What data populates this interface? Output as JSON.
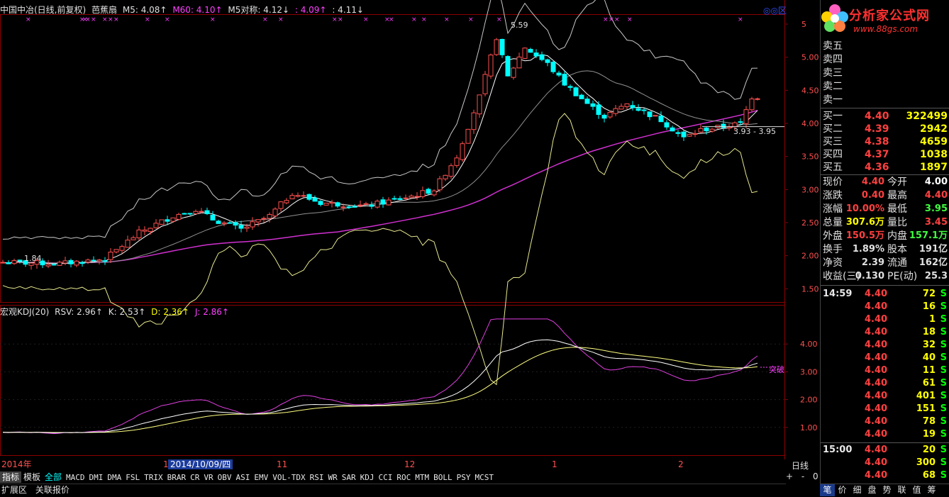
{
  "header": {
    "stock_name": "中国中冶(日线,前复权)",
    "indicator": "芭蕉扇",
    "m5": "M5: 4.08↑",
    "m60": "M60: 4.10↑",
    "m5dc": "M5对称: 4.12↓",
    "v1": ": 4.09↑",
    "v2": ": 4.11↓",
    "top_right": "◎◎区"
  },
  "kdj_header": {
    "title": "宏观KDJ(20)",
    "rsv": "RSV: 2.96↑",
    "k": "K: 2.53↑",
    "d": "D: 2.36↑",
    "j": "J: 2.86↑"
  },
  "annotations": {
    "high": "5.59",
    "low": "1.84",
    "range": "3.93 - 3.95",
    "breakout": "突破"
  },
  "xaxis": {
    "labels": [
      "2014年",
      "1",
      "2014/10/09/四",
      "11",
      "12",
      "1",
      "2"
    ],
    "period": "日线",
    "controls": "+ - 0"
  },
  "tabs": [
    "指标",
    "模板",
    "全部",
    "MACD",
    "DMI",
    "DMA",
    "FSL",
    "TRIX",
    "BRAR",
    "CR",
    "VR",
    "OBV",
    "ASI",
    "EMV",
    "VOL-TDX",
    "RSI",
    "WR",
    "SAR",
    "KDJ",
    "CCI",
    "ROC",
    "MTM",
    "BOLL",
    "PSY",
    "MCST"
  ],
  "status": [
    "扩展区",
    "关联报价"
  ],
  "logo": {
    "name": "分析家公式网",
    "url": "www.88gs.com"
  },
  "quote": {
    "sell": [
      {
        "label": "卖五"
      },
      {
        "label": "卖四"
      },
      {
        "label": "卖三"
      },
      {
        "label": "卖二"
      },
      {
        "label": "卖一"
      }
    ],
    "buy": [
      {
        "label": "买一",
        "price": "4.40",
        "vol": "322499"
      },
      {
        "label": "买二",
        "price": "4.39",
        "vol": "2942"
      },
      {
        "label": "买三",
        "price": "4.38",
        "vol": "4659"
      },
      {
        "label": "买四",
        "price": "4.37",
        "vol": "1038"
      },
      {
        "label": "买五",
        "price": "4.36",
        "vol": "1897"
      }
    ],
    "stats": [
      {
        "l1": "现价",
        "v1": "4.40",
        "l2": "今开",
        "v2": "4.00"
      },
      {
        "l1": "涨跌",
        "v1": "0.40",
        "l2": "最高",
        "v2": "4.40"
      },
      {
        "l1": "涨幅",
        "v1": "10.00%",
        "l2": "最低",
        "v2": "3.95"
      },
      {
        "l1": "总量",
        "v1": "307.6万",
        "l2": "量比",
        "v2": "3.45"
      },
      {
        "l1": "外盘",
        "v1": "150.5万",
        "l2": "内盘",
        "v2": "157.1万"
      },
      {
        "l1": "换手",
        "v1": "1.89%",
        "l2": "股本",
        "v2": "191亿"
      },
      {
        "l1": "净资",
        "v1": "2.39",
        "l2": "流通",
        "v2": "162亿"
      },
      {
        "l1": "收益(三)",
        "v1": "0.130",
        "l2": "PE(动)",
        "v2": "25.3"
      }
    ]
  },
  "ticks": [
    {
      "t": "14:59",
      "p": "4.40",
      "v": "72",
      "s": "S"
    },
    {
      "t": "",
      "p": "4.40",
      "v": "16",
      "s": "S"
    },
    {
      "t": "",
      "p": "4.40",
      "v": "1",
      "s": "S"
    },
    {
      "t": "",
      "p": "4.40",
      "v": "18",
      "s": "S"
    },
    {
      "t": "",
      "p": "4.40",
      "v": "32",
      "s": "S"
    },
    {
      "t": "",
      "p": "4.40",
      "v": "40",
      "s": "S"
    },
    {
      "t": "",
      "p": "4.40",
      "v": "11",
      "s": "S"
    },
    {
      "t": "",
      "p": "4.40",
      "v": "61",
      "s": "S"
    },
    {
      "t": "",
      "p": "4.40",
      "v": "401",
      "s": "S"
    },
    {
      "t": "",
      "p": "4.40",
      "v": "151",
      "s": "S"
    },
    {
      "t": "",
      "p": "4.40",
      "v": "78",
      "s": "S"
    },
    {
      "t": "",
      "p": "4.40",
      "v": "19",
      "s": "S"
    },
    {
      "t": "15:00",
      "p": "4.40",
      "v": "20",
      "s": "S"
    },
    {
      "t": "",
      "p": "4.40",
      "v": "300",
      "s": "S"
    },
    {
      "t": "",
      "p": "4.40",
      "v": "68",
      "s": "S"
    }
  ],
  "panel_tabs": [
    "笔",
    "价",
    "细",
    "盘",
    "势",
    "联",
    "值",
    "筹"
  ],
  "chart_data": {
    "type": "candlestick",
    "price_axis": {
      "ticks": [
        "5",
        "5.00",
        "4.50",
        "4.00",
        "3.50",
        "3.00",
        "2.50",
        "2.00",
        "1.50"
      ]
    },
    "kdj_axis": {
      "ticks": [
        "4.00",
        "3.00",
        "2.00",
        "1.00"
      ]
    },
    "price_range": [
      1.3,
      5.65
    ],
    "kdj_range": [
      0,
      5
    ]
  }
}
